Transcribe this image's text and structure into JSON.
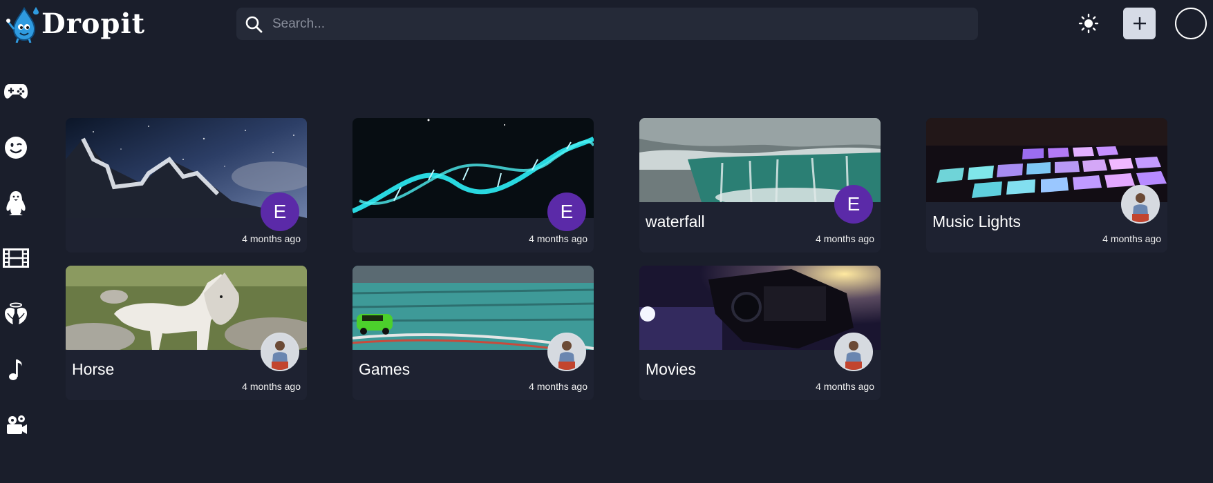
{
  "app": {
    "brand": "Dropit",
    "icons": {
      "logo": "water-drop-mascot-icon"
    }
  },
  "header": {
    "search": {
      "placeholder": "Search...",
      "value": ""
    },
    "theme_toggle_icon": "sun-icon",
    "add_button_icon": "plus-icon",
    "avatar_icon": "user-avatar-icon"
  },
  "sidebar": {
    "items": [
      {
        "icon": "gamepad-icon",
        "category": "Games"
      },
      {
        "icon": "smiley-icon",
        "category": "Memes"
      },
      {
        "icon": "penguin-icon",
        "category": "Animals"
      },
      {
        "icon": "film-strip-icon",
        "category": "Movies"
      },
      {
        "icon": "angel-wings-icon",
        "category": "Spiritual"
      },
      {
        "icon": "music-note-icon",
        "category": "Music"
      },
      {
        "icon": "film-camera-icon",
        "category": "Videos"
      }
    ]
  },
  "feed": {
    "cards": [
      {
        "title": "",
        "time": "4 months ago",
        "author_initial": "E",
        "author_type": "letter",
        "thumb": "starry-mountain"
      },
      {
        "title": "",
        "time": "4 months ago",
        "author_initial": "E",
        "author_type": "letter",
        "thumb": "dna-helix"
      },
      {
        "title": "waterfall",
        "time": "4 months ago",
        "author_initial": "E",
        "author_type": "letter",
        "thumb": "waterfall"
      },
      {
        "title": "Music Lights",
        "time": "4 months ago",
        "author_initial": "",
        "author_type": "photo",
        "thumb": "led-pad"
      },
      {
        "title": "Horse",
        "time": "4 months ago",
        "author_initial": "",
        "author_type": "photo",
        "thumb": "white-horse"
      },
      {
        "title": "Games",
        "time": "4 months ago",
        "author_initial": "",
        "author_type": "photo",
        "thumb": "race-track"
      },
      {
        "title": "Movies",
        "time": "4 months ago",
        "author_initial": "",
        "author_type": "photo",
        "thumb": "film-camera"
      }
    ]
  },
  "colors": {
    "background": "#1a1e2b",
    "card": "#1e2231",
    "search_bg": "#252a38",
    "author_purple": "#5b2aa8",
    "add_button_bg": "#d6dbe6"
  }
}
